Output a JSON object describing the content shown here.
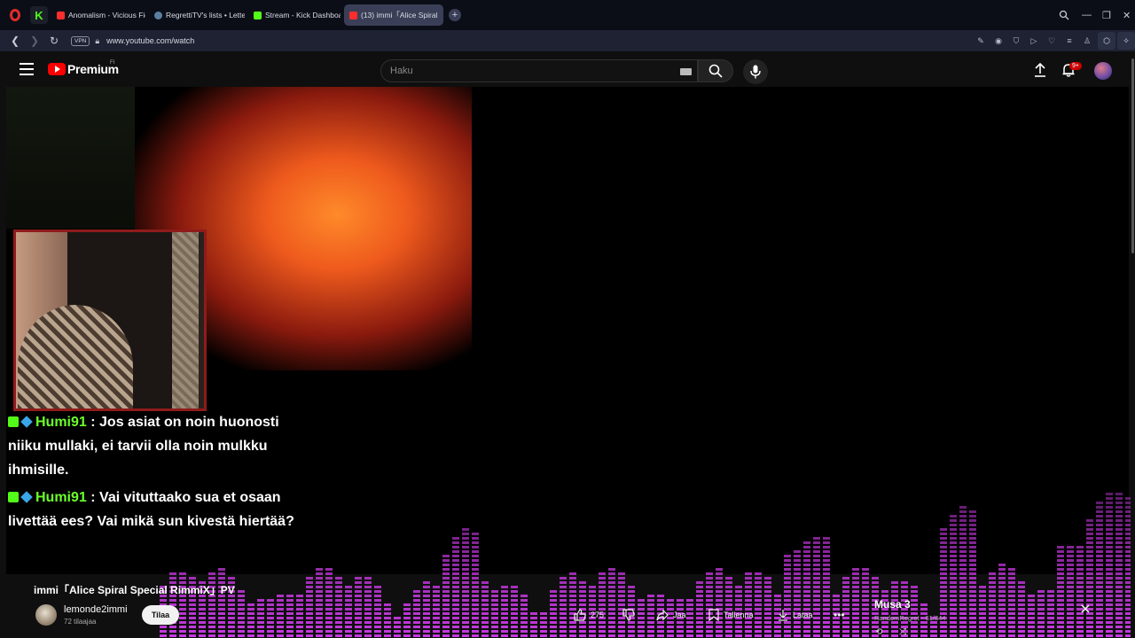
{
  "browser": {
    "tabs": [
      {
        "label": "Anomalism - Vicious Fictio",
        "favicon": "youtube",
        "active": false
      },
      {
        "label": "RegrettiTV's lists • Letterb",
        "favicon": "letterboxd",
        "active": false
      },
      {
        "label": "Stream - Kick Dashboard",
        "favicon": "kick",
        "active": false
      },
      {
        "label": "(13) immi「Alice Spiral",
        "favicon": "youtube",
        "active": true
      }
    ],
    "vpn_label": "VPN",
    "url": "www.youtube.com/watch"
  },
  "youtube": {
    "brand": "Premium",
    "region": "FI",
    "search_placeholder": "Haku",
    "notification_count": "9+"
  },
  "chat": {
    "messages": [
      {
        "user": "Humi91",
        "separator": ":",
        "text": "Jos asiat on noin huonosti niiku mullaki, ei tarvii olla noin mulkku ihmisille."
      },
      {
        "user": "Humi91",
        "separator": ":",
        "text": "Vai vituttaako sua et osaan livettää ees? Vai mikä sun kivestä hiertää?"
      }
    ]
  },
  "video": {
    "title": "immi「Alice Spiral Special RimmiX」PV",
    "channel": "lemonde2immi",
    "subscribers": "72 tilaajaa",
    "subscribe_label": "Tilaa",
    "likes": "275",
    "share_label": "Jaa",
    "save_label": "Tallenna",
    "download_label": "Lataa"
  },
  "playlist": {
    "title": "Musa 3",
    "subtitle": "RandomRegret - 61/844"
  },
  "colors": {
    "youtube_red": "#ff0000",
    "kick_green": "#53fc18",
    "viz_magenta": "#d43cf0",
    "active_tab": "#3a3f57"
  }
}
